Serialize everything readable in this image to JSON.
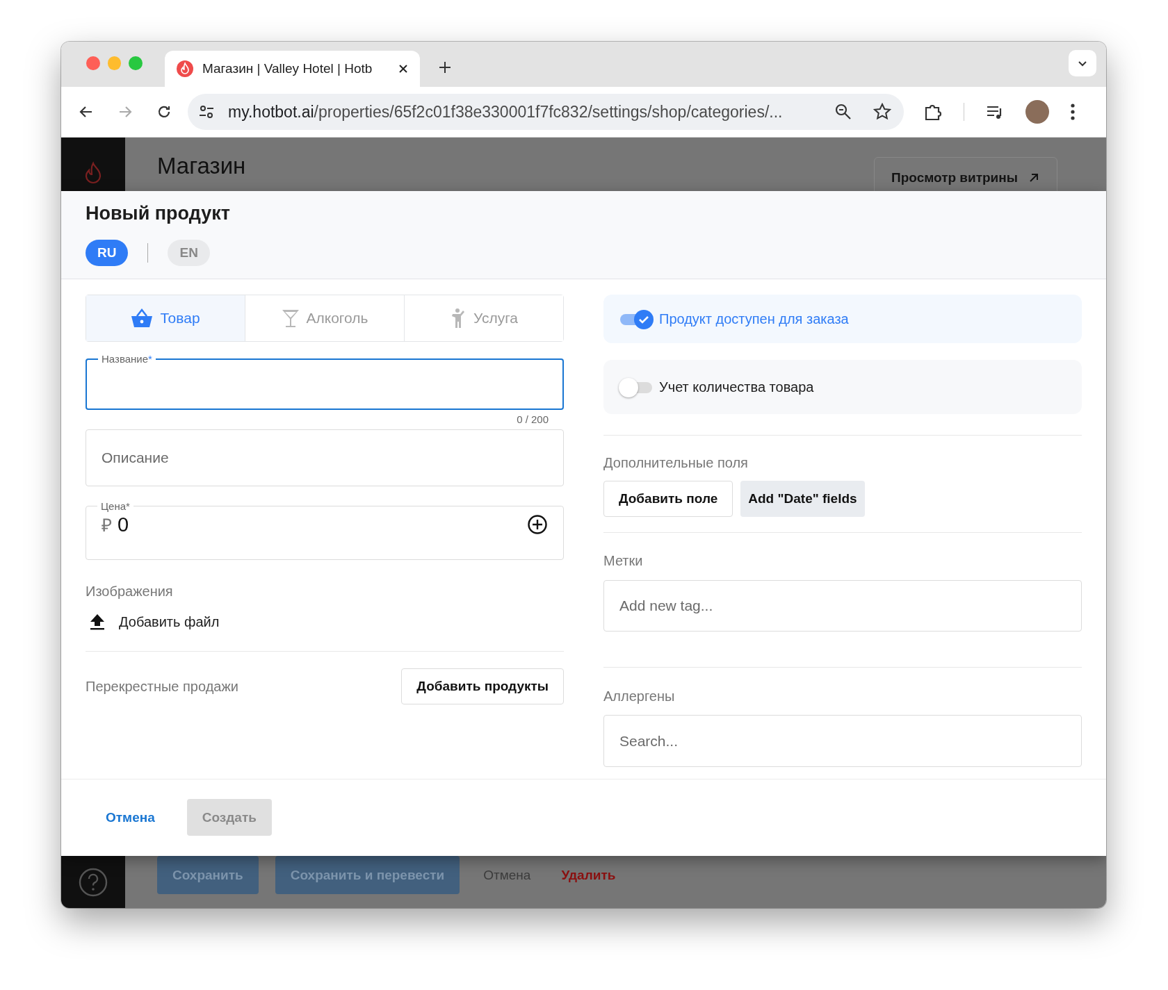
{
  "browser": {
    "tab_title": "Магазин | Valley Hotel | Hotb",
    "url_host": "my.hotbot.ai",
    "url_path": "/properties/65f2c01f38e330001f7fc832/settings/shop/categories/..."
  },
  "page": {
    "title": "Магазин",
    "preview_button": "Просмотр витрины"
  },
  "modal": {
    "title": "Новый продукт",
    "languages": [
      {
        "label": "RU",
        "selected": true
      },
      {
        "label": "EN",
        "selected": false
      }
    ],
    "product_types": [
      {
        "label": "Товар",
        "kind": "basket",
        "selected": true
      },
      {
        "label": "Алкоголь",
        "kind": "glass",
        "selected": false
      },
      {
        "label": "Услуга",
        "kind": "person",
        "selected": false
      }
    ],
    "name_field": {
      "label": "Название",
      "required_mark": "*",
      "focused": true,
      "counter": "0 / 200"
    },
    "description_field": {
      "placeholder": "Описание"
    },
    "price_field": {
      "label": "Цена",
      "required_mark": "*",
      "currency": "₽",
      "value": "0"
    },
    "images": {
      "label": "Изображения",
      "add_file": "Добавить файл"
    },
    "cross_sales": {
      "label": "Перекрестные продажи",
      "button": "Добавить продукты"
    },
    "toggles": [
      {
        "label": "Продукт доступен для заказа",
        "on": true
      },
      {
        "label": "Учет количества товара",
        "on": false
      }
    ],
    "extra_fields": {
      "label": "Дополнительные поля",
      "buttons": [
        {
          "label": "Добавить поле",
          "kind": "outline"
        },
        {
          "label": "Add \"Date\" fields",
          "kind": "filled"
        }
      ]
    },
    "tags": {
      "label": "Метки",
      "placeholder": "Add new tag..."
    },
    "allergens": {
      "label": "Аллергены",
      "placeholder": "Search..."
    },
    "footer": {
      "cancel": "Отмена",
      "create": {
        "label": "Создать",
        "disabled": true
      }
    }
  },
  "bottom_bar": {
    "buttons": [
      {
        "label": "Сохранить",
        "kind": "primary"
      },
      {
        "label": "Сохранить и перевести",
        "kind": "primary"
      },
      {
        "label": "Отмена",
        "kind": "text"
      },
      {
        "label": "Удалить",
        "kind": "danger"
      }
    ]
  }
}
